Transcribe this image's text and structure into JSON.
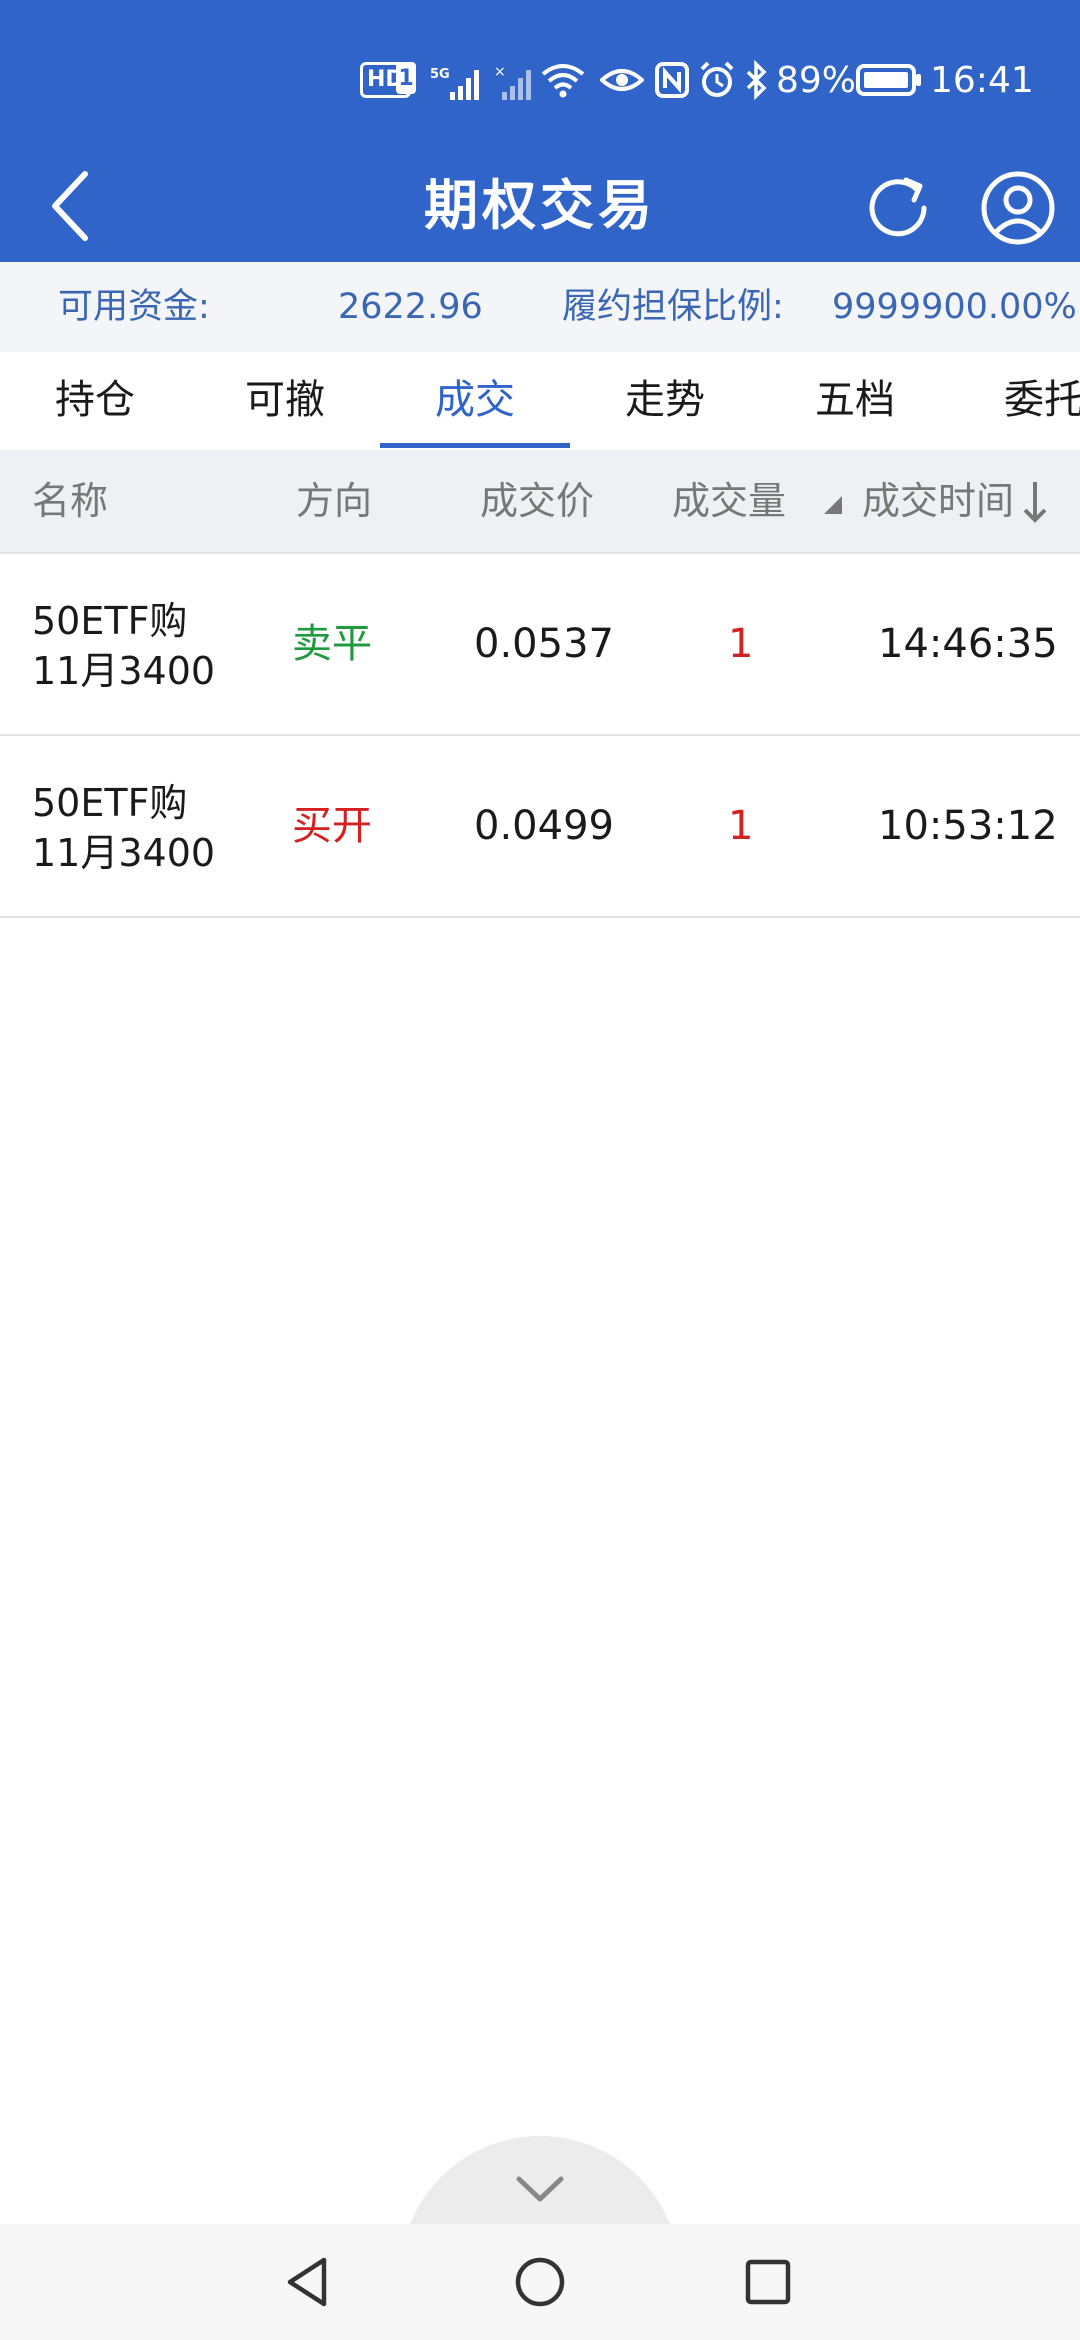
{
  "status_bar": {
    "hd": "HD",
    "sim": "1",
    "net": "5G",
    "battery": "89%",
    "time": "16:41"
  },
  "header": {
    "title": "期权交易"
  },
  "funds": {
    "available_label": "可用资金:",
    "available_value": "2622.96",
    "margin_label": "履约担保比例:",
    "margin_value": "9999900.00%"
  },
  "tabs": [
    {
      "label": "持仓"
    },
    {
      "label": "可撤"
    },
    {
      "label": "成交"
    },
    {
      "label": "走势"
    },
    {
      "label": "五档"
    },
    {
      "label": "委托"
    }
  ],
  "active_tab": "成交",
  "table": {
    "headers": {
      "name": "名称",
      "direction": "方向",
      "price": "成交价",
      "quantity": "成交量",
      "time": "成交时间"
    },
    "rows": [
      {
        "name_line1": "50ETF购",
        "name_line2": "11月3400",
        "direction": "卖平",
        "direction_color": "#1f9a3c",
        "price": "0.0537",
        "quantity": "1",
        "time": "14:46:35"
      },
      {
        "name_line1": "50ETF购",
        "name_line2": "11月3400",
        "direction": "买开",
        "direction_color": "#d42020",
        "price": "0.0499",
        "quantity": "1",
        "time": "10:53:12"
      }
    ]
  },
  "colors": {
    "primary": "#3064c8",
    "buy": "#d42020",
    "sell": "#1f9a3c"
  },
  "icons": {
    "back": "chevron-left-icon",
    "refresh": "refresh-icon",
    "user": "user-icon",
    "pull": "chevron-down-icon",
    "nav_back": "triangle-back-icon",
    "nav_home": "circle-home-icon",
    "nav_recent": "square-recent-icon"
  }
}
